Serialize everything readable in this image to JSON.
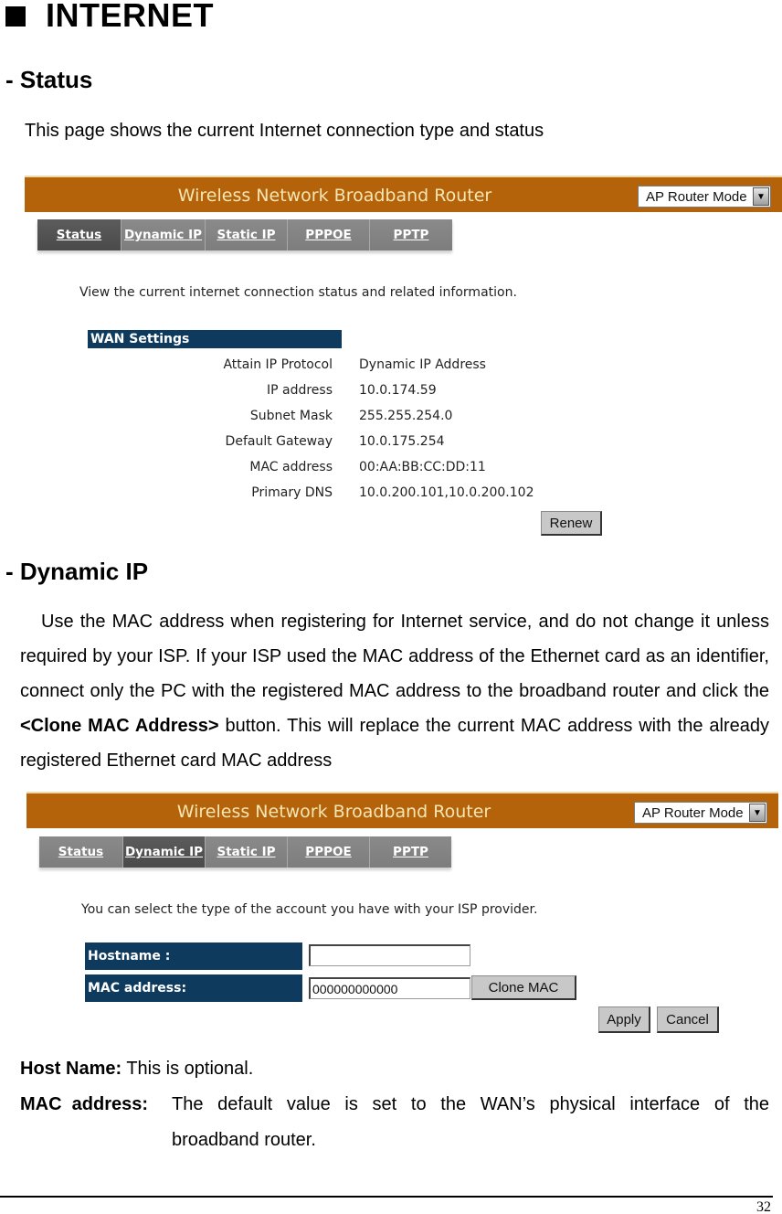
{
  "section": {
    "title": "INTERNET",
    "bullet_icon": "black-square-bullet"
  },
  "status_section": {
    "heading": "- Status",
    "intro": "This page shows the current Internet connection type and status"
  },
  "router": {
    "banner_title": "Wireless Network Broadband Router",
    "mode_select": {
      "selected": "AP Router Mode",
      "arrow_icon": "chevron-down-icon"
    },
    "tabs": [
      {
        "label": "Status"
      },
      {
        "label": "Dynamic IP"
      },
      {
        "label": "Static IP"
      },
      {
        "label": "PPPOE"
      },
      {
        "label": "PPTP"
      }
    ],
    "colors": {
      "banner": "#b5630a",
      "banner_text": "#f5e6b4",
      "tab_bg": "#8c8c8c",
      "tab_active": "#4f4f4f",
      "table_header": "#0e3a5e"
    }
  },
  "status_screen": {
    "active_tab": "Status",
    "description": "View the current internet connection status and related information.",
    "wan_header": "WAN Settings",
    "rows": [
      {
        "label": "Attain IP Protocol",
        "value": "Dynamic IP Address"
      },
      {
        "label": "IP address",
        "value": "10.0.174.59"
      },
      {
        "label": "Subnet Mask",
        "value": "255.255.254.0"
      },
      {
        "label": "Default Gateway",
        "value": "10.0.175.254"
      },
      {
        "label": "MAC address",
        "value": "00:AA:BB:CC:DD:11"
      },
      {
        "label": "Primary DNS",
        "value": "10.0.200.101,10.0.200.102"
      }
    ],
    "renew_button": "Renew"
  },
  "dynamic_section": {
    "heading": "- Dynamic IP",
    "para_before_bold": "Use the MAC address when registering for Internet service, and do not change it unless required by your ISP. If your ISP used the MAC address of the Ethernet card as an identifier, connect only the PC with the registered MAC address to the broadband router and click the ",
    "para_bold": "<Clone MAC Address>",
    "para_after_bold": " button. This will replace the current MAC address with the already registered Ethernet card MAC address"
  },
  "dynamic_screen": {
    "active_tab": "Dynamic IP",
    "description": "You can select the type of the account you have with your ISP provider.",
    "hostname_label": "Hostname :",
    "hostname_value": "",
    "mac_label": "MAC address:",
    "mac_value": "000000000000",
    "clone_button": "Clone MAC",
    "apply_button": "Apply",
    "cancel_button": "Cancel"
  },
  "definitions": [
    {
      "term": "Host Name:",
      "text": "This is optional."
    },
    {
      "term": "MAC  address:",
      "text": "The  default  value  is  set  to  the  WAN’s  physical  interface  of  the",
      "continuation": "broadband router."
    }
  ],
  "page_number": "32"
}
